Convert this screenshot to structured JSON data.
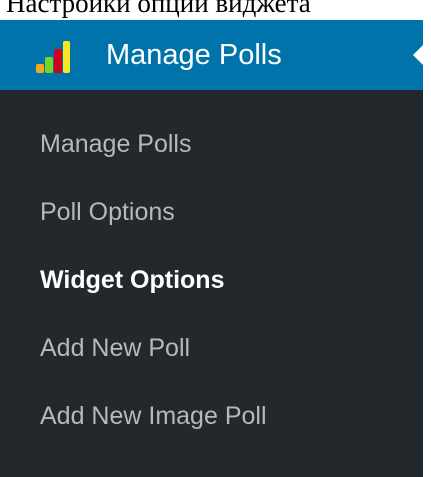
{
  "top_strip": {
    "text": "Настройки опции виджета"
  },
  "menu": {
    "title": "Manage Polls",
    "logo_icon": "poll-chart-icon",
    "colors": {
      "header_bg": "#0073aa",
      "menu_bg": "#23282d",
      "text": "#b4b9be",
      "active_text": "#ffffff"
    },
    "items": [
      {
        "label": "Manage Polls",
        "active": false
      },
      {
        "label": "Poll Options",
        "active": false
      },
      {
        "label": "Widget Options",
        "active": true
      },
      {
        "label": "Add New Poll",
        "active": false
      },
      {
        "label": "Add New Image Poll",
        "active": false
      }
    ]
  }
}
